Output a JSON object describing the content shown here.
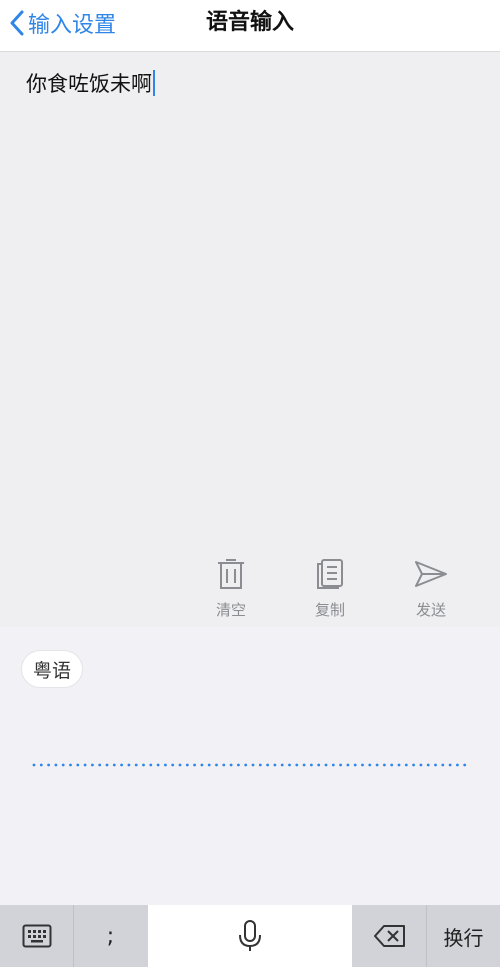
{
  "navbar": {
    "back_label": "输入设置",
    "title": "语音输入"
  },
  "editor": {
    "text": "你食咗饭未啊"
  },
  "actions": [
    {
      "label": "清空",
      "icon": "trash-icon"
    },
    {
      "label": "复制",
      "icon": "copy-icon"
    },
    {
      "label": "发送",
      "icon": "send-icon"
    }
  ],
  "voice": {
    "language": "粤语"
  },
  "keyboard": {
    "semicolon": ";",
    "return_label": "换行",
    "icons": [
      "keyboard-icon",
      "microphone-icon",
      "delete-icon"
    ]
  },
  "colors": {
    "accent": "#2f86e8",
    "label_gray": "#8b8d92"
  }
}
